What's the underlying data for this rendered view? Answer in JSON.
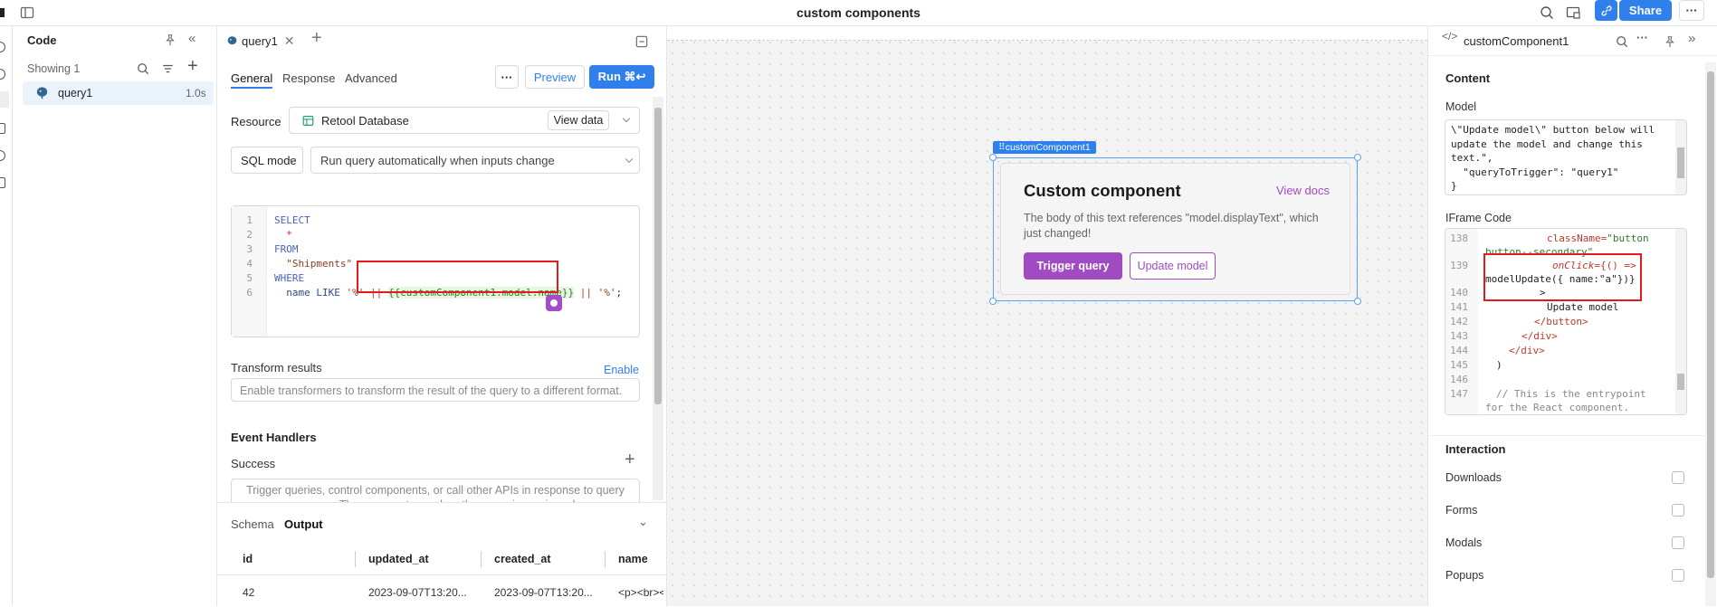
{
  "app": {
    "title": "custom components",
    "share_label": "Share"
  },
  "code_panel": {
    "title": "Code",
    "showing": "Showing 1",
    "queries": [
      {
        "name": "query1",
        "time": "1.0s"
      }
    ]
  },
  "query_panel": {
    "tab_name": "query1",
    "tabs": [
      "General",
      "Response",
      "Advanced"
    ],
    "preview_label": "Preview",
    "run_label": "Run ⌘↩",
    "resource_label": "Resource",
    "resource_value": "Retool Database",
    "view_data_label": "View data",
    "mode_value": "SQL mode",
    "run_mode_value": "Run query automatically when inputs change",
    "code": {
      "lines": [
        "1",
        "2",
        "3",
        "4",
        "5",
        "6"
      ],
      "l1": "SELECT",
      "l2": "  *",
      "l3": "FROM",
      "l4": "  \"Shipments\"",
      "l5": "WHERE",
      "l6a": "  name LIKE ",
      "l6b": "'%'",
      "l6c": " || ",
      "l6d": "{{customComponent1.model.name}}",
      "l6e": " || ",
      "l6f": "'%'",
      "l6g": ";"
    },
    "transform_label": "Transform results",
    "enable_label": "Enable",
    "transform_placeholder": "Enable transformers to transform the result of the query to a different format.",
    "event_handlers_label": "Event Handlers",
    "success_label": "Success",
    "success_placeholder": "Trigger queries, control components, or call other APIs in response to query success. These are not run when the query is previewed.",
    "bottom_tabs": [
      "Schema",
      "Output"
    ],
    "table": {
      "columns": [
        "id",
        "updated_at",
        "created_at",
        "name"
      ],
      "rows": [
        [
          "42",
          "2023-09-07T13:20...",
          "2023-09-07T13:20...",
          "<p><br><"
        ]
      ]
    }
  },
  "canvas": {
    "component_tag": "customComponent1",
    "card_title": "Custom component",
    "view_docs": "View docs",
    "card_body": "The body of this text references \"model.displayText\", which just changed!",
    "trigger_label": "Trigger query",
    "update_label": "Update model"
  },
  "inspector": {
    "component_name": "customComponent1",
    "content_label": "Content",
    "model_label": "Model",
    "model_lines": [
      "\\\"Update model\\\" button below will",
      "update the model and change this",
      "text.\",",
      "  \"queryToTrigger\": \"query1\"",
      "}"
    ],
    "iframe_label": "IFrame Code",
    "iframe": {
      "n138": "138",
      "l138a": "className=",
      "l138b": "\"button",
      "l138c": "button--secondary\"",
      "n139": "139",
      "l139a": "onClick=",
      "l139b": "{() =>",
      "l139c": "modelUpdate({ name:\"a\"})}",
      "n140": "140",
      "l140": ">",
      "n141": "141",
      "l141": "Update model",
      "n142": "142",
      "l142": "</button>",
      "n143": "143",
      "l143": "</div>",
      "n144": "144",
      "l144": "</div>",
      "n145": "145",
      "l145": ")",
      "n146": "146",
      "n147": "147",
      "l147a": "// This is the entrypoint",
      "l147b": "for the React component."
    },
    "interaction_label": "Interaction",
    "interaction_items": [
      "Downloads",
      "Forms",
      "Modals",
      "Popups"
    ]
  }
}
